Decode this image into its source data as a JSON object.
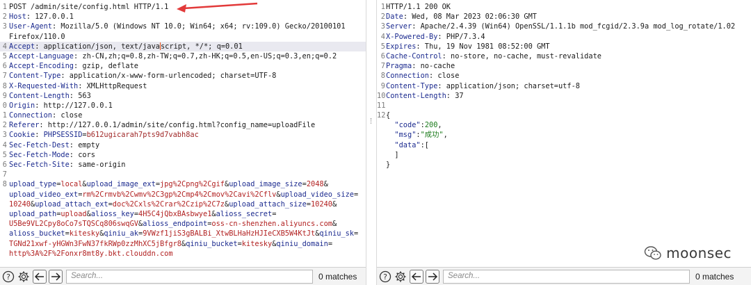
{
  "request": {
    "lines": [
      {
        "n": "1",
        "parts": [
          {
            "t": "POST /admin/site/config.html HTTP/1.1",
            "c": "val"
          }
        ]
      },
      {
        "n": "2",
        "parts": [
          {
            "t": "Host",
            "c": "key"
          },
          {
            "t": ": 127.0.0.1",
            "c": "val"
          }
        ]
      },
      {
        "n": "3",
        "parts": [
          {
            "t": "User-Agent",
            "c": "key"
          },
          {
            "t": ": Mozilla/5.0 (Windows NT 10.0; Win64; x64; rv:109.0) Gecko/20100101",
            "c": "val"
          }
        ]
      },
      {
        "n": "",
        "parts": [
          {
            "t": "Firefox/110.0",
            "c": "val"
          }
        ]
      },
      {
        "n": "4",
        "hl": true,
        "parts": [
          {
            "t": "Accept",
            "c": "key"
          },
          {
            "t": ": application/json, text/java",
            "c": "val"
          },
          {
            "cursor": true
          },
          {
            "t": "script, */*; q=0.01",
            "c": "val"
          }
        ]
      },
      {
        "n": "5",
        "parts": [
          {
            "t": "Accept-Language",
            "c": "key"
          },
          {
            "t": ": zh-CN,zh;q=0.8,zh-TW;q=0.7,zh-HK;q=0.5,en-US;q=0.3,en;q=0.2",
            "c": "val"
          }
        ]
      },
      {
        "n": "6",
        "parts": [
          {
            "t": "Accept-Encoding",
            "c": "key"
          },
          {
            "t": ": gzip, deflate",
            "c": "val"
          }
        ]
      },
      {
        "n": "7",
        "parts": [
          {
            "t": "Content-Type",
            "c": "key"
          },
          {
            "t": ": application/x-www-form-urlencoded; charset=UTF-8",
            "c": "val"
          }
        ]
      },
      {
        "n": "8",
        "parts": [
          {
            "t": "X-Requested-With",
            "c": "key"
          },
          {
            "t": ": XMLHttpRequest",
            "c": "val"
          }
        ]
      },
      {
        "n": "9",
        "parts": [
          {
            "t": "Content-Length",
            "c": "key"
          },
          {
            "t": ": 563",
            "c": "val"
          }
        ]
      },
      {
        "n": "0",
        "parts": [
          {
            "t": "Origin",
            "c": "key"
          },
          {
            "t": ": http://127.0.0.1",
            "c": "val"
          }
        ]
      },
      {
        "n": "1",
        "parts": [
          {
            "t": "Connection",
            "c": "key"
          },
          {
            "t": ": close",
            "c": "val"
          }
        ]
      },
      {
        "n": "2",
        "parts": [
          {
            "t": "Referer",
            "c": "key"
          },
          {
            "t": ": http://127.0.0.1/admin/site/config.html?config_name=uploadFile",
            "c": "val"
          }
        ]
      },
      {
        "n": "3",
        "parts": [
          {
            "t": "Cookie",
            "c": "key"
          },
          {
            "t": ": ",
            "c": "val"
          },
          {
            "t": "PHPSESSID",
            "c": "pk"
          },
          {
            "t": "=",
            "c": "val"
          },
          {
            "t": "b612ugicarah7pts9d7vabh8ac",
            "c": "ck"
          }
        ]
      },
      {
        "n": "4",
        "parts": [
          {
            "t": "Sec-Fetch-Dest",
            "c": "key"
          },
          {
            "t": ": empty",
            "c": "val"
          }
        ]
      },
      {
        "n": "5",
        "parts": [
          {
            "t": "Sec-Fetch-Mode",
            "c": "key"
          },
          {
            "t": ": cors",
            "c": "val"
          }
        ]
      },
      {
        "n": "6",
        "parts": [
          {
            "t": "Sec-Fetch-Site",
            "c": "key"
          },
          {
            "t": ": same-origin",
            "c": "val"
          }
        ]
      },
      {
        "n": "7",
        "parts": []
      },
      {
        "n": "8",
        "parts": [
          {
            "t": "upload_type",
            "c": "pk"
          },
          {
            "t": "=",
            "c": "val"
          },
          {
            "t": "local",
            "c": "pv"
          },
          {
            "t": "&",
            "c": "val"
          },
          {
            "t": "upload_image_ext",
            "c": "pk"
          },
          {
            "t": "=",
            "c": "val"
          },
          {
            "t": "jpg%2Cpng%2Cgif",
            "c": "pv"
          },
          {
            "t": "&",
            "c": "val"
          },
          {
            "t": "upload_image_size",
            "c": "pk"
          },
          {
            "t": "=",
            "c": "val"
          },
          {
            "t": "2048",
            "c": "pv"
          },
          {
            "t": "&",
            "c": "val"
          }
        ]
      },
      {
        "n": "",
        "parts": [
          {
            "t": "upload_video_ext",
            "c": "pk"
          },
          {
            "t": "=",
            "c": "val"
          },
          {
            "t": "rm%2Crmvb%2Cwmv%2C3gp%2Cmp4%2Cmov%2Cavi%2Cflv",
            "c": "pv"
          },
          {
            "t": "&",
            "c": "val"
          },
          {
            "t": "upload_video_size",
            "c": "pk"
          },
          {
            "t": "=",
            "c": "val"
          }
        ]
      },
      {
        "n": "",
        "parts": [
          {
            "t": "10240",
            "c": "pv"
          },
          {
            "t": "&",
            "c": "val"
          },
          {
            "t": "upload_attach_ext",
            "c": "pk"
          },
          {
            "t": "=",
            "c": "val"
          },
          {
            "t": "doc%2Cxls%2Crar%2Czip%2C7z",
            "c": "pv"
          },
          {
            "t": "&",
            "c": "val"
          },
          {
            "t": "upload_attach_size",
            "c": "pk"
          },
          {
            "t": "=",
            "c": "val"
          },
          {
            "t": "10240",
            "c": "pv"
          },
          {
            "t": "&",
            "c": "val"
          }
        ]
      },
      {
        "n": "",
        "parts": [
          {
            "t": "upload_path",
            "c": "pk"
          },
          {
            "t": "=",
            "c": "val"
          },
          {
            "t": "upload",
            "c": "pv"
          },
          {
            "t": "&",
            "c": "val"
          },
          {
            "t": "alioss_key",
            "c": "pk"
          },
          {
            "t": "=",
            "c": "val"
          },
          {
            "t": "4H5C4jQbxBAsbwye1",
            "c": "pv"
          },
          {
            "t": "&",
            "c": "val"
          },
          {
            "t": "alioss_secret",
            "c": "pk"
          },
          {
            "t": "=",
            "c": "val"
          }
        ]
      },
      {
        "n": "",
        "parts": [
          {
            "t": "U5Be9VL2Cpy8oCo7sTQSCq806swqGV",
            "c": "pv"
          },
          {
            "t": "&",
            "c": "val"
          },
          {
            "t": "alioss_endpoint",
            "c": "pk"
          },
          {
            "t": "=",
            "c": "val"
          },
          {
            "t": "oss-cn-shenzhen.aliyuncs.com",
            "c": "pv"
          },
          {
            "t": "&",
            "c": "val"
          }
        ]
      },
      {
        "n": "",
        "parts": [
          {
            "t": "alioss_bucket",
            "c": "pk"
          },
          {
            "t": "=",
            "c": "val"
          },
          {
            "t": "kitesky",
            "c": "pv"
          },
          {
            "t": "&",
            "c": "val"
          },
          {
            "t": "qiniu_ak",
            "c": "pk"
          },
          {
            "t": "=",
            "c": "val"
          },
          {
            "t": "9VWzf1jiS3gBALBi_XtwBLHaHzHJIeCXB5W4KtJt",
            "c": "pv"
          },
          {
            "t": "&",
            "c": "val"
          },
          {
            "t": "qiniu_sk",
            "c": "pk"
          },
          {
            "t": "=",
            "c": "val"
          }
        ]
      },
      {
        "n": "",
        "parts": [
          {
            "t": "TGNd21xwf-yHGWn3FwN37fkRWp0zzMhXC5jBfgr8",
            "c": "pv"
          },
          {
            "t": "&",
            "c": "val"
          },
          {
            "t": "qiniu_bucket",
            "c": "pk"
          },
          {
            "t": "=",
            "c": "val"
          },
          {
            "t": "kitesky",
            "c": "pv"
          },
          {
            "t": "&",
            "c": "val"
          },
          {
            "t": "qiniu_domain",
            "c": "pk"
          },
          {
            "t": "=",
            "c": "val"
          }
        ]
      },
      {
        "n": "",
        "parts": [
          {
            "t": "http%3A%2F%2Fonxr8mt8y.bkt.clouddn.com",
            "c": "pv"
          }
        ]
      }
    ]
  },
  "response": {
    "lines": [
      {
        "n": "1",
        "parts": [
          {
            "t": "HTTP/1.1 200 OK",
            "c": "val"
          }
        ]
      },
      {
        "n": "2",
        "parts": [
          {
            "t": "Date",
            "c": "key"
          },
          {
            "t": ": Wed, 08 Mar 2023 02:06:30 GMT",
            "c": "val"
          }
        ]
      },
      {
        "n": "3",
        "parts": [
          {
            "t": "Server",
            "c": "key"
          },
          {
            "t": ": Apache/2.4.39 (Win64) OpenSSL/1.1.1b mod_fcgid/2.3.9a mod_log_rotate/1.02",
            "c": "val"
          }
        ]
      },
      {
        "n": "4",
        "parts": [
          {
            "t": "X-Powered-By",
            "c": "key"
          },
          {
            "t": ": PHP/7.3.4",
            "c": "val"
          }
        ]
      },
      {
        "n": "5",
        "parts": [
          {
            "t": "Expires",
            "c": "key"
          },
          {
            "t": ": Thu, 19 Nov 1981 08:52:00 GMT",
            "c": "val"
          }
        ]
      },
      {
        "n": "6",
        "parts": [
          {
            "t": "Cache-Control",
            "c": "key"
          },
          {
            "t": ": no-store, no-cache, must-revalidate",
            "c": "val"
          }
        ]
      },
      {
        "n": "7",
        "parts": [
          {
            "t": "Pragma",
            "c": "key"
          },
          {
            "t": ": no-cache",
            "c": "val"
          }
        ]
      },
      {
        "n": "8",
        "parts": [
          {
            "t": "Connection",
            "c": "key"
          },
          {
            "t": ": close",
            "c": "val"
          }
        ]
      },
      {
        "n": "9",
        "parts": [
          {
            "t": "Content-Type",
            "c": "key"
          },
          {
            "t": ": application/json; charset=utf-8",
            "c": "val"
          }
        ]
      },
      {
        "n": "10",
        "parts": [
          {
            "t": "Content-Length",
            "c": "key"
          },
          {
            "t": ": 37",
            "c": "val"
          }
        ]
      },
      {
        "n": "11",
        "parts": []
      },
      {
        "n": "12",
        "parts": [
          {
            "t": "{",
            "c": "val"
          }
        ]
      },
      {
        "n": "",
        "parts": [
          {
            "t": "  \"code\"",
            "c": "jk"
          },
          {
            "t": ":",
            "c": "val"
          },
          {
            "t": "200",
            "c": "jn"
          },
          {
            "t": ",",
            "c": "val"
          }
        ]
      },
      {
        "n": "",
        "parts": [
          {
            "t": "  \"msg\"",
            "c": "jk"
          },
          {
            "t": ":",
            "c": "val"
          },
          {
            "t": "\"成功\"",
            "c": "js"
          },
          {
            "t": ",",
            "c": "val"
          }
        ]
      },
      {
        "n": "",
        "parts": [
          {
            "t": "  \"data\"",
            "c": "jk"
          },
          {
            "t": ":[",
            "c": "val"
          }
        ]
      },
      {
        "n": "",
        "parts": [
          {
            "t": "  ]",
            "c": "val"
          }
        ]
      },
      {
        "n": "",
        "parts": [
          {
            "t": "}",
            "c": "val"
          }
        ]
      }
    ]
  },
  "toolbar_left": {
    "search_placeholder": "Search...",
    "matches": "0 matches"
  },
  "toolbar_right": {
    "search_placeholder": "Search...",
    "matches": "0 matches"
  },
  "watermark": {
    "text": "moonsec"
  },
  "colors": {
    "accent_arrow": "#e23a3a",
    "header_key": "#1c2b8f",
    "param_value": "#b22222"
  }
}
